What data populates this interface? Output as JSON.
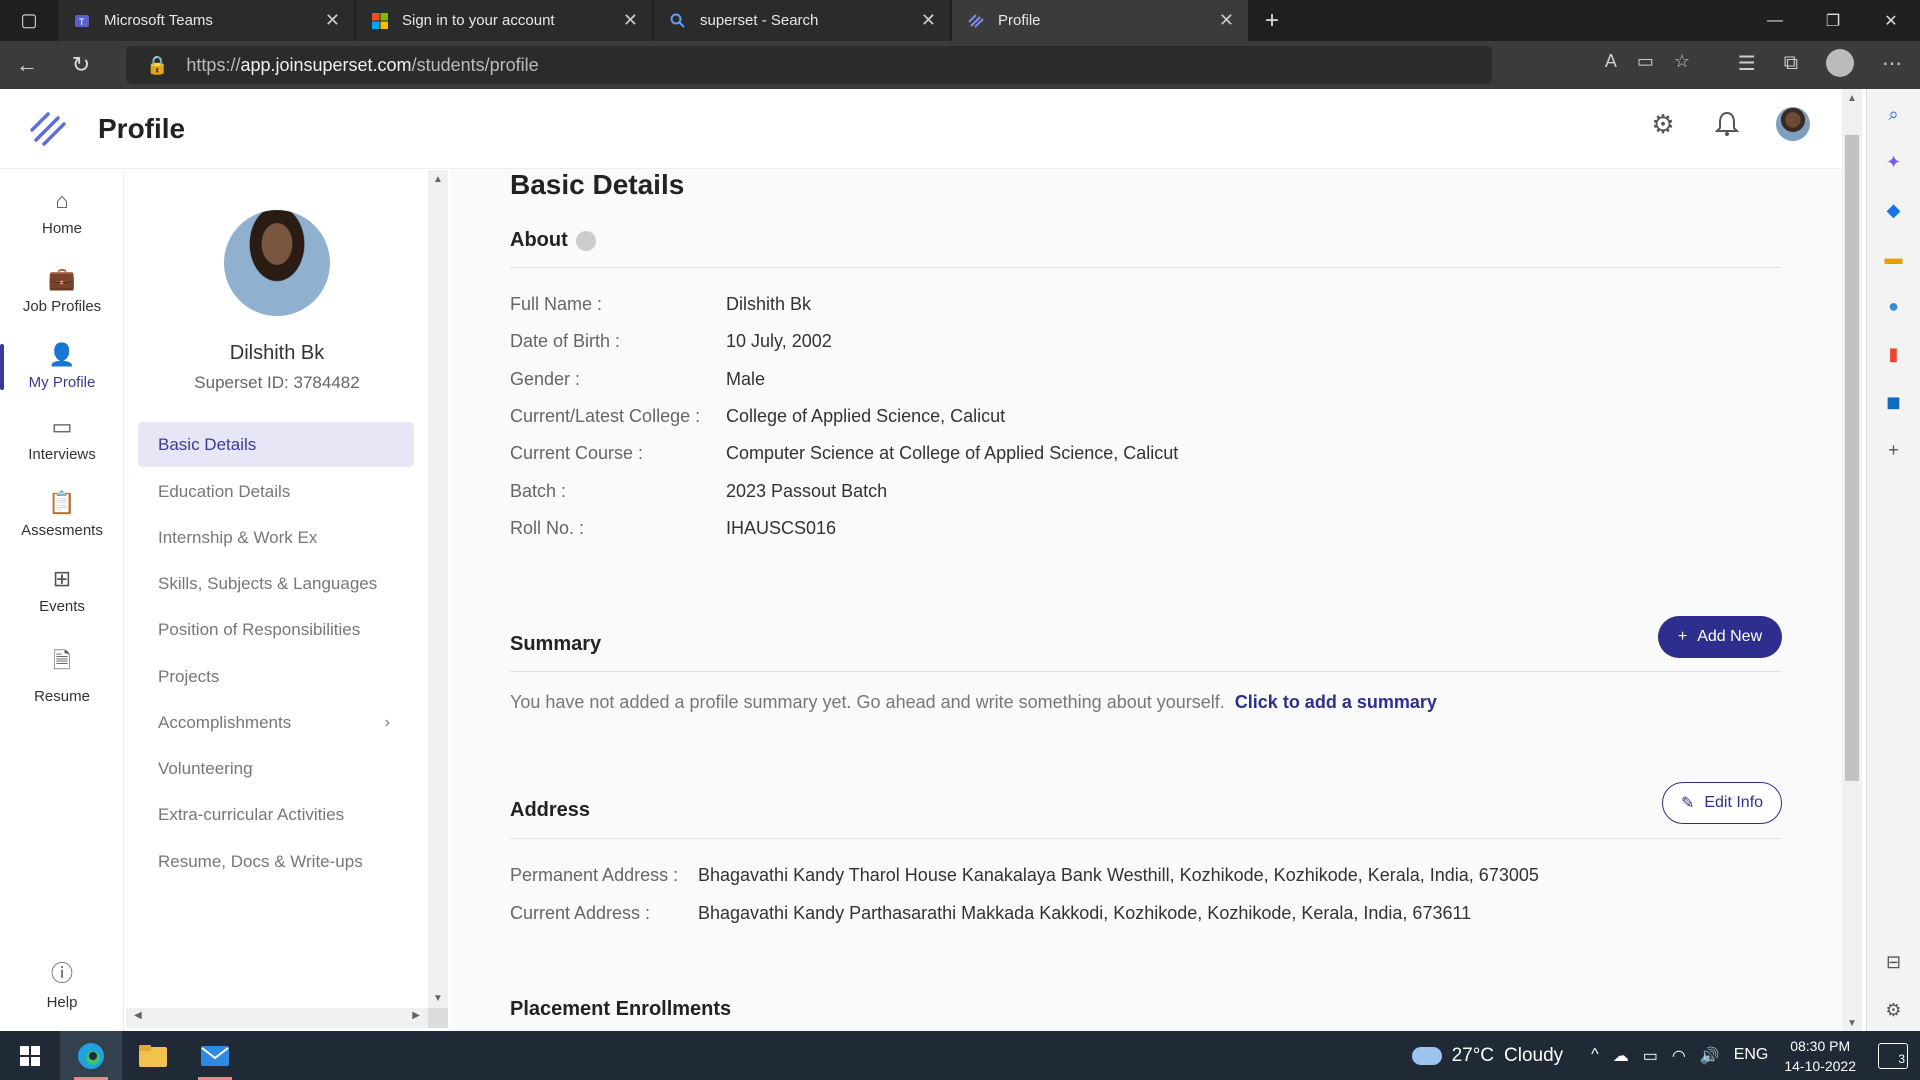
{
  "browser": {
    "tabs": [
      {
        "title": "Microsoft Teams",
        "favicon": "teams-icon",
        "active": false
      },
      {
        "title": "Sign in to your account",
        "favicon": "microsoft-icon",
        "active": false
      },
      {
        "title": "superset - Search",
        "favicon": "search-icon",
        "active": false
      },
      {
        "title": "Profile",
        "favicon": "superset-icon",
        "active": true
      }
    ],
    "url_scheme": "https://",
    "url_host": "app.joinsuperset.com",
    "url_path": "/students/profile"
  },
  "app": {
    "page_title": "Profile",
    "accent_color": "#2e2e8e"
  },
  "left_nav": {
    "items": [
      {
        "label": "Home",
        "icon": "home-icon"
      },
      {
        "label": "Job Profiles",
        "icon": "briefcase-icon"
      },
      {
        "label": "My Profile",
        "icon": "person-icon",
        "active": true
      },
      {
        "label": "Interviews",
        "icon": "interview-icon"
      },
      {
        "label": "Assesments",
        "icon": "clipboard-icon"
      },
      {
        "label": "Events",
        "icon": "grid-icon"
      },
      {
        "label": "Resume",
        "icon": "document-icon"
      }
    ],
    "help_label": "Help"
  },
  "profile": {
    "name": "Dilshith Bk",
    "superset_id": "Superset ID: 3784482",
    "menu": [
      {
        "label": "Basic Details",
        "active": true
      },
      {
        "label": "Education Details"
      },
      {
        "label": "Internship & Work Ex"
      },
      {
        "label": "Skills, Subjects & Languages"
      },
      {
        "label": "Position of Responsibilities"
      },
      {
        "label": "Projects"
      },
      {
        "label": "Accomplishments",
        "has_chevron": true
      },
      {
        "label": "Volunteering"
      },
      {
        "label": "Extra-curricular Activities"
      },
      {
        "label": "Resume, Docs & Write-ups"
      }
    ]
  },
  "main": {
    "heading": "Basic Details",
    "about": {
      "title": "About",
      "rows": [
        {
          "label": "Full Name :",
          "value": "Dilshith Bk"
        },
        {
          "label": "Date of Birth :",
          "value": "10 July, 2002"
        },
        {
          "label": "Gender :",
          "value": "Male"
        },
        {
          "label": "Current/Latest College :",
          "value": "College of Applied Science, Calicut"
        },
        {
          "label": "Current Course :",
          "value": "Computer Science at College of Applied Science, Calicut"
        },
        {
          "label": "Batch :",
          "value": "2023 Passout Batch"
        },
        {
          "label": "Roll No. :",
          "value": "IHAUSCS016"
        }
      ]
    },
    "summary": {
      "title": "Summary",
      "add_button": "Add New",
      "empty_text": "You have not added a profile summary yet. Go ahead and write something about yourself.",
      "link_text": "Click to add a summary"
    },
    "address": {
      "title": "Address",
      "edit_button": "Edit Info",
      "rows": [
        {
          "label": "Permanent Address :",
          "value": "Bhagavathi Kandy Tharol House Kanakalaya Bank Westhill, Kozhikode, Kozhikode, Kerala, India, 673005"
        },
        {
          "label": "Current Address :",
          "value": "Bhagavathi Kandy Parthasarathi Makkada Kakkodi, Kozhikode, Kozhikode, Kerala, India, 673611"
        }
      ]
    },
    "placement_title": "Placement Enrollments"
  },
  "taskbar": {
    "weather_temp": "27°C",
    "weather_desc": "Cloudy",
    "lang": "ENG",
    "time": "08:30 PM",
    "date": "14-10-2022",
    "notifications": "3"
  }
}
